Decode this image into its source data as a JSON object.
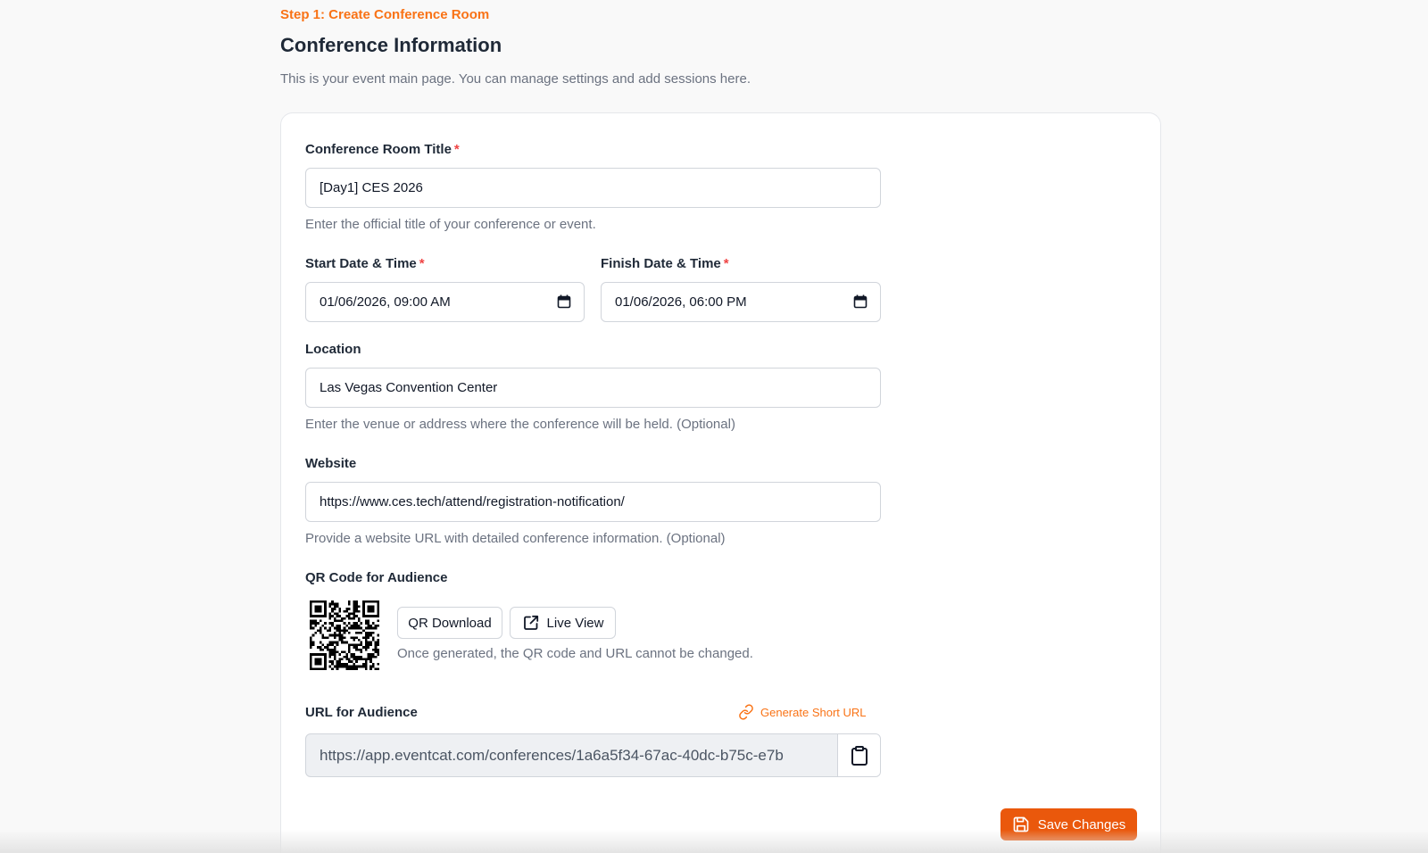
{
  "header": {
    "step": "Step 1: Create Conference Room",
    "title": "Conference Information",
    "subtitle": "This is your event main page. You can manage settings and add sessions here."
  },
  "form": {
    "title_field": {
      "label": "Conference Room Title",
      "required_mark": "*",
      "value": "[Day1] CES 2026",
      "help": "Enter the official title of your conference or event."
    },
    "start": {
      "label": "Start Date & Time",
      "required_mark": "*",
      "value": "01/06/2026, 09:00 AM"
    },
    "finish": {
      "label": "Finish Date & Time",
      "required_mark": "*",
      "value": "01/06/2026, 06:00 PM"
    },
    "location": {
      "label": "Location",
      "value": "Las Vegas Convention Center",
      "help": "Enter the venue or address where the conference will be held. (Optional)"
    },
    "website": {
      "label": "Website",
      "value": "https://www.ces.tech/attend/registration-notification/",
      "help": "Provide a website URL with detailed conference information. (Optional)"
    },
    "qr": {
      "label": "QR Code for Audience",
      "download_label": "QR Download",
      "live_view_label": "Live View",
      "note": "Once generated, the QR code and URL cannot be changed."
    },
    "audience_url": {
      "label": "URL for Audience",
      "generate_label": "Generate Short URL",
      "value": "https://app.eventcat.com/conferences/1a6a5f34-67ac-40dc-b75c-e7b"
    }
  },
  "actions": {
    "save_label": "Save Changes"
  },
  "colors": {
    "accent": "#f97316",
    "save_button": "#ea580c",
    "required": "#ef4444"
  },
  "icons": {
    "date_picker": "calendar-icon",
    "live_view": "external-link-icon",
    "generate": "link-icon",
    "copy": "clipboard-icon",
    "save": "save-icon"
  }
}
